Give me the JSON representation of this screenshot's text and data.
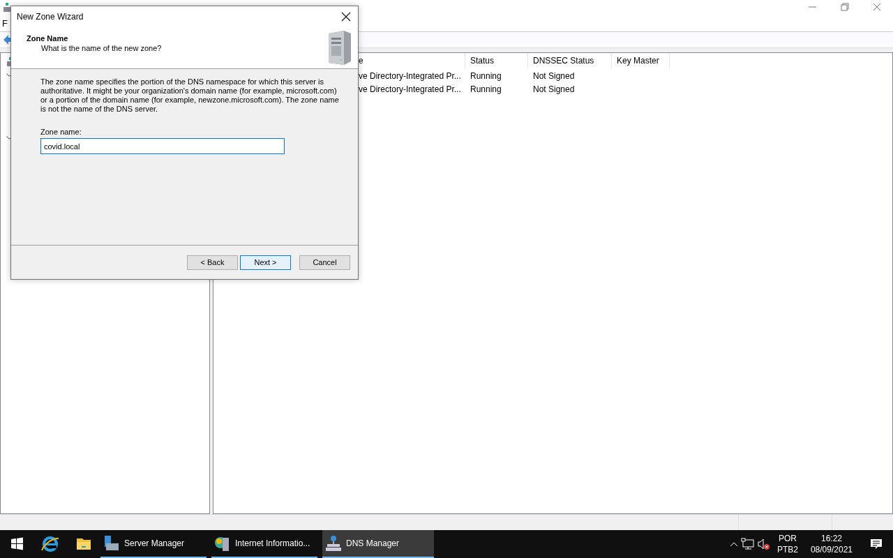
{
  "main_window": {
    "menu": [
      {
        "label": "F"
      }
    ],
    "tree": [
      {
        "expanded": true
      },
      {
        "expanded": true
      }
    ],
    "table": {
      "columns": [
        "e",
        "Status",
        "DNSSEC Status",
        "Key Master"
      ],
      "rows": [
        {
          "column_1": "ve Directory-Integrated Pr...",
          "status": "Running",
          "dnssec_status": "Not Signed"
        },
        {
          "column_1": "ve Directory-Integrated Pr...",
          "status": "Running",
          "dnssec_status": "Not Signed"
        }
      ]
    }
  },
  "dialog": {
    "title": "New Zone Wizard",
    "heading": "Zone Name",
    "subheading": "What is the name of the new zone?",
    "description": "The zone name specifies the portion of the DNS namespace for which this server is authoritative. It might be your organization's domain name (for example,  microsoft.com) or a portion of the domain name (for example, newzone.microsoft.com). The zone name is not the name of the DNS server.",
    "field": {
      "label": "Zone name:",
      "value": "covid.local"
    },
    "buttons": [
      {
        "label": "< Back",
        "default": false
      },
      {
        "label": "Next >",
        "default": true
      },
      {
        "label": "Cancel",
        "default": false
      }
    ]
  },
  "taskbar": {
    "apps": [
      {
        "label": "Server Manager",
        "selected": false,
        "kind": "server"
      },
      {
        "label": "Internet Informatio...",
        "selected": false,
        "kind": "iis"
      },
      {
        "label": "DNS Manager",
        "selected": true,
        "kind": "dns"
      }
    ],
    "tray": {
      "language": "POR",
      "layout": "PTB2",
      "time": "16:22",
      "date": "08/09/2021"
    }
  }
}
